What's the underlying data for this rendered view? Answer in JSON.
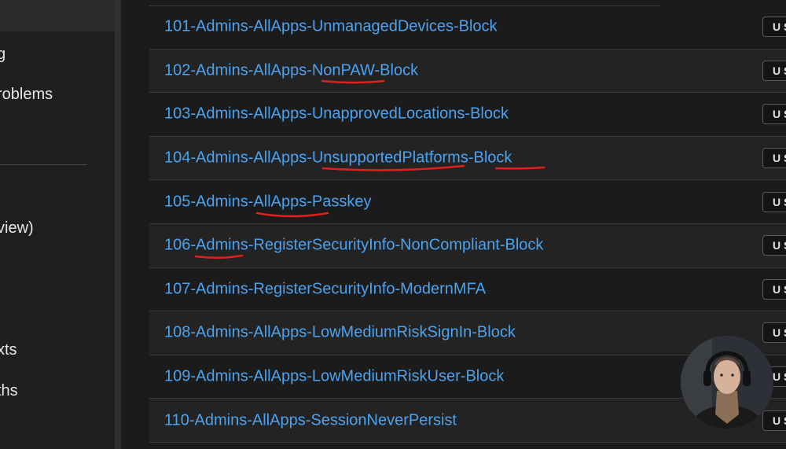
{
  "sidebar": {
    "items": [
      {
        "label": "g"
      },
      {
        "label": "roblems"
      },
      {
        "label": "view)"
      },
      {
        "label": "xts"
      },
      {
        "label": "ths"
      }
    ]
  },
  "policies": [
    {
      "name": "101-Admins-AllApps-UnmanagedDevices-Block",
      "state": "U S"
    },
    {
      "name": "102-Admins-AllApps-NonPAW-Block",
      "state": "U S"
    },
    {
      "name": "103-Admins-AllApps-UnapprovedLocations-Block",
      "state": "U S"
    },
    {
      "name": "104-Admins-AllApps-UnsupportedPlatforms-Block",
      "state": "U S"
    },
    {
      "name": "105-Admins-AllApps-Passkey",
      "state": "U S"
    },
    {
      "name": "106-Admins-RegisterSecurityInfo-NonCompliant-Block",
      "state": "U S"
    },
    {
      "name": "107-Admins-RegisterSecurityInfo-ModernMFA",
      "state": "U S"
    },
    {
      "name": "108-Admins-AllApps-LowMediumRiskSignIn-Block",
      "state": "U S"
    },
    {
      "name": "109-Admins-AllApps-LowMediumRiskUser-Block",
      "state": "U S"
    },
    {
      "name": "110-Admins-AllApps-SessionNeverPersist",
      "state": "U S"
    }
  ],
  "colors": {
    "link": "#4aa3f0",
    "annotation": "#e0201c",
    "background": "#1b1b1b"
  }
}
